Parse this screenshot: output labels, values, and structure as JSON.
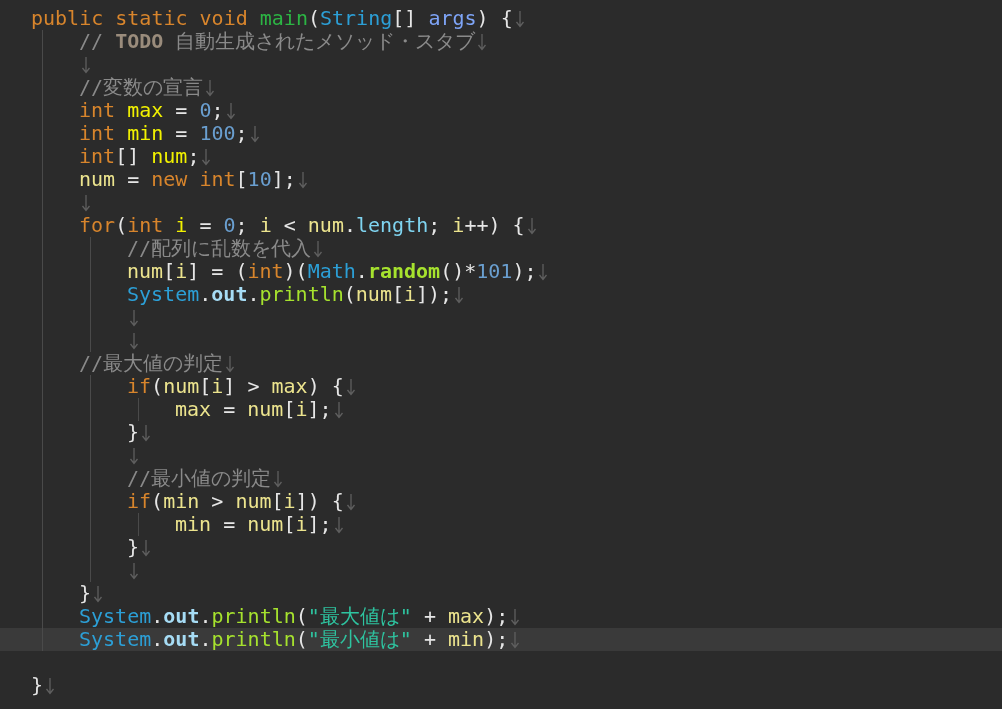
{
  "editor": {
    "lines": [
      {
        "eol": true,
        "current": false,
        "tokens": [
          {
            "kind": "keyword",
            "text": "public static void "
          },
          {
            "kind": "method-decl",
            "text": "main"
          },
          {
            "kind": "punct",
            "text": "("
          },
          {
            "kind": "type",
            "text": "String"
          },
          {
            "kind": "punct",
            "text": "[] "
          },
          {
            "kind": "param",
            "text": "args"
          },
          {
            "kind": "punct",
            "text": ") {"
          }
        ],
        "children": [
          {
            "eol": true,
            "current": false,
            "tokens": [
              {
                "kind": "comment",
                "text": "// "
              },
              {
                "kind": "todo",
                "text": "TODO"
              },
              {
                "kind": "comment",
                "text": " 自動生成されたメソッド・スタブ"
              }
            ]
          },
          {
            "eol": true,
            "current": false
          },
          {
            "eol": true,
            "current": false,
            "tokens": [
              {
                "kind": "comment",
                "text": "//変数の宣言"
              }
            ]
          },
          {
            "eol": true,
            "current": false,
            "tokens": [
              {
                "kind": "keyword",
                "text": "int "
              },
              {
                "kind": "var-decl",
                "text": "max"
              },
              {
                "kind": "punct",
                "text": " = "
              },
              {
                "kind": "number",
                "text": "0"
              },
              {
                "kind": "punct",
                "text": ";"
              }
            ]
          },
          {
            "eol": true,
            "current": false,
            "tokens": [
              {
                "kind": "keyword",
                "text": "int "
              },
              {
                "kind": "var-decl",
                "text": "min"
              },
              {
                "kind": "punct",
                "text": " = "
              },
              {
                "kind": "number",
                "text": "100"
              },
              {
                "kind": "punct",
                "text": ";"
              }
            ]
          },
          {
            "eol": true,
            "current": false,
            "tokens": [
              {
                "kind": "keyword",
                "text": "int"
              },
              {
                "kind": "punct",
                "text": "[] "
              },
              {
                "kind": "var-decl",
                "text": "num"
              },
              {
                "kind": "punct",
                "text": ";"
              }
            ]
          },
          {
            "eol": true,
            "current": false,
            "tokens": [
              {
                "kind": "var",
                "text": "num"
              },
              {
                "kind": "punct",
                "text": " = "
              },
              {
                "kind": "keyword",
                "text": "new "
              },
              {
                "kind": "keyword",
                "text": "int"
              },
              {
                "kind": "punct",
                "text": "["
              },
              {
                "kind": "number",
                "text": "10"
              },
              {
                "kind": "punct",
                "text": "];"
              }
            ]
          },
          {
            "eol": true,
            "current": false
          },
          {
            "eol": true,
            "current": false,
            "tokens": [
              {
                "kind": "keyword",
                "text": "for"
              },
              {
                "kind": "punct",
                "text": "("
              },
              {
                "kind": "keyword",
                "text": "int "
              },
              {
                "kind": "var-decl",
                "text": "i"
              },
              {
                "kind": "punct",
                "text": " = "
              },
              {
                "kind": "number",
                "text": "0"
              },
              {
                "kind": "punct",
                "text": "; "
              },
              {
                "kind": "var",
                "text": "i"
              },
              {
                "kind": "punct",
                "text": " < "
              },
              {
                "kind": "var",
                "text": "num"
              },
              {
                "kind": "punct",
                "text": "."
              },
              {
                "kind": "field",
                "text": "length"
              },
              {
                "kind": "punct",
                "text": "; "
              },
              {
                "kind": "var",
                "text": "i"
              },
              {
                "kind": "punct",
                "text": "++) {"
              }
            ],
            "children": [
              {
                "eol": true,
                "current": false,
                "tokens": [
                  {
                    "kind": "comment",
                    "text": "//配列に乱数を代入"
                  }
                ]
              },
              {
                "eol": true,
                "current": false,
                "tokens": [
                  {
                    "kind": "var",
                    "text": "num"
                  },
                  {
                    "kind": "punct",
                    "text": "["
                  },
                  {
                    "kind": "var",
                    "text": "i"
                  },
                  {
                    "kind": "punct",
                    "text": "] = ("
                  },
                  {
                    "kind": "keyword",
                    "text": "int"
                  },
                  {
                    "kind": "punct",
                    "text": ")("
                  },
                  {
                    "kind": "type",
                    "text": "Math"
                  },
                  {
                    "kind": "punct",
                    "text": "."
                  },
                  {
                    "kind": "static-method",
                    "text": "random"
                  },
                  {
                    "kind": "punct",
                    "text": "()*"
                  },
                  {
                    "kind": "number",
                    "text": "101"
                  },
                  {
                    "kind": "punct",
                    "text": ");"
                  }
                ]
              },
              {
                "eol": true,
                "current": false,
                "tokens": [
                  {
                    "kind": "type",
                    "text": "System"
                  },
                  {
                    "kind": "punct",
                    "text": "."
                  },
                  {
                    "kind": "static-field",
                    "text": "out"
                  },
                  {
                    "kind": "punct",
                    "text": "."
                  },
                  {
                    "kind": "method",
                    "text": "println"
                  },
                  {
                    "kind": "punct",
                    "text": "("
                  },
                  {
                    "kind": "var",
                    "text": "num"
                  },
                  {
                    "kind": "punct",
                    "text": "["
                  },
                  {
                    "kind": "var",
                    "text": "i"
                  },
                  {
                    "kind": "punct",
                    "text": "]);"
                  }
                ]
              },
              {
                "eol": true,
                "current": false
              },
              {
                "eol": true,
                "current": false
              }
            ]
          },
          {
            "eol": true,
            "current": false,
            "tokens": [
              {
                "kind": "comment",
                "text": "//最大値の判定"
              }
            ],
            "children": [
              {
                "eol": true,
                "current": false,
                "tokens": [
                  {
                    "kind": "keyword",
                    "text": "if"
                  },
                  {
                    "kind": "punct",
                    "text": "("
                  },
                  {
                    "kind": "var",
                    "text": "num"
                  },
                  {
                    "kind": "punct",
                    "text": "["
                  },
                  {
                    "kind": "var",
                    "text": "i"
                  },
                  {
                    "kind": "punct",
                    "text": "] > "
                  },
                  {
                    "kind": "var",
                    "text": "max"
                  },
                  {
                    "kind": "punct",
                    "text": ") {"
                  }
                ],
                "children": [
                  {
                    "eol": true,
                    "current": false,
                    "tokens": [
                      {
                        "kind": "var",
                        "text": "max"
                      },
                      {
                        "kind": "punct",
                        "text": " = "
                      },
                      {
                        "kind": "var",
                        "text": "num"
                      },
                      {
                        "kind": "punct",
                        "text": "["
                      },
                      {
                        "kind": "var",
                        "text": "i"
                      },
                      {
                        "kind": "punct",
                        "text": "];"
                      }
                    ]
                  }
                ]
              },
              {
                "eol": true,
                "current": false,
                "tokens": [
                  {
                    "kind": "punct",
                    "text": "}"
                  }
                ]
              },
              {
                "eol": true,
                "current": false
              },
              {
                "eol": true,
                "current": false,
                "tokens": [
                  {
                    "kind": "comment",
                    "text": "//最小値の判定"
                  }
                ]
              },
              {
                "eol": true,
                "current": false,
                "tokens": [
                  {
                    "kind": "keyword",
                    "text": "if"
                  },
                  {
                    "kind": "punct",
                    "text": "("
                  },
                  {
                    "kind": "var",
                    "text": "min"
                  },
                  {
                    "kind": "punct",
                    "text": " > "
                  },
                  {
                    "kind": "var",
                    "text": "num"
                  },
                  {
                    "kind": "punct",
                    "text": "["
                  },
                  {
                    "kind": "var",
                    "text": "i"
                  },
                  {
                    "kind": "punct",
                    "text": "]) {"
                  }
                ],
                "children": [
                  {
                    "eol": true,
                    "current": false,
                    "tokens": [
                      {
                        "kind": "var",
                        "text": "min"
                      },
                      {
                        "kind": "punct",
                        "text": " = "
                      },
                      {
                        "kind": "var",
                        "text": "num"
                      },
                      {
                        "kind": "punct",
                        "text": "["
                      },
                      {
                        "kind": "var",
                        "text": "i"
                      },
                      {
                        "kind": "punct",
                        "text": "];"
                      }
                    ]
                  }
                ]
              },
              {
                "eol": true,
                "current": false,
                "tokens": [
                  {
                    "kind": "punct",
                    "text": "}"
                  }
                ]
              },
              {
                "eol": true,
                "current": false
              }
            ]
          },
          {
            "eol": true,
            "current": false,
            "tokens": [
              {
                "kind": "punct",
                "text": "}"
              }
            ]
          },
          {
            "eol": true,
            "current": false,
            "tokens": [
              {
                "kind": "type",
                "text": "System"
              },
              {
                "kind": "punct",
                "text": "."
              },
              {
                "kind": "static-field",
                "text": "out"
              },
              {
                "kind": "punct",
                "text": "."
              },
              {
                "kind": "method",
                "text": "println"
              },
              {
                "kind": "punct",
                "text": "("
              },
              {
                "kind": "string",
                "text": "\"最大値は\""
              },
              {
                "kind": "punct",
                "text": " + "
              },
              {
                "kind": "var",
                "text": "max"
              },
              {
                "kind": "punct",
                "text": ");"
              }
            ]
          },
          {
            "eol": true,
            "current": true,
            "tokens": [
              {
                "kind": "type",
                "text": "System"
              },
              {
                "kind": "punct",
                "text": "."
              },
              {
                "kind": "static-field",
                "text": "out"
              },
              {
                "kind": "punct",
                "text": "."
              },
              {
                "kind": "method",
                "text": "println"
              },
              {
                "kind": "punct",
                "text": "("
              },
              {
                "kind": "string",
                "text": "\"最小値は\""
              },
              {
                "kind": "punct",
                "text": " + "
              },
              {
                "kind": "var",
                "text": "min"
              },
              {
                "kind": "punct",
                "text": ");"
              }
            ]
          }
        ]
      },
      {
        "eol": false,
        "current": false
      },
      {
        "eol": true,
        "current": false,
        "tokens": [
          {
            "kind": "punct",
            "text": "}"
          }
        ]
      }
    ]
  }
}
